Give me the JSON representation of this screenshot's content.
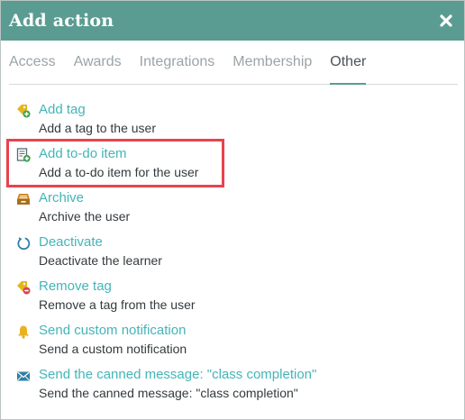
{
  "dialog": {
    "title": "Add action",
    "close_icon": "close-x-icon"
  },
  "tabs": [
    {
      "label": "Access",
      "active": false
    },
    {
      "label": "Awards",
      "active": false
    },
    {
      "label": "Integrations",
      "active": false
    },
    {
      "label": "Membership",
      "active": false
    },
    {
      "label": "Other",
      "active": true
    }
  ],
  "actions": [
    {
      "title": "Add tag",
      "description": "Add a tag to the user",
      "icon": "tag-add-icon"
    },
    {
      "title": "Add to-do item",
      "description": "Add a to-do item for the user",
      "icon": "todo-add-icon",
      "highlighted": true
    },
    {
      "title": "Archive",
      "description": "Archive the user",
      "icon": "archive-box-icon"
    },
    {
      "title": "Deactivate",
      "description": "Deactivate the learner",
      "icon": "rotate-icon"
    },
    {
      "title": "Remove tag",
      "description": "Remove a tag from the user",
      "icon": "tag-remove-icon"
    },
    {
      "title": "Send custom notification",
      "description": "Send a custom notification",
      "icon": "bell-icon"
    },
    {
      "title": "Send the canned message: \"class completion\"",
      "description": "Send the canned message: \"class completion\"",
      "icon": "envelope-icon"
    }
  ],
  "colors": {
    "header": "#5b9c92",
    "link": "#43b5b8",
    "highlight": "#e8434e"
  }
}
